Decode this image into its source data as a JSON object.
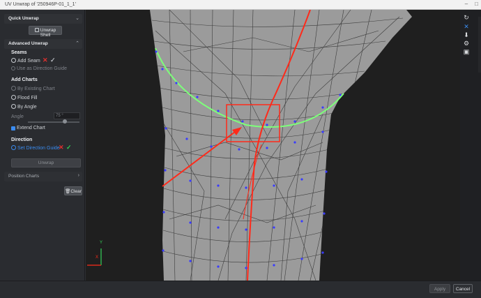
{
  "window": {
    "title": "UV Unwrap of '250946P-01_1_1'"
  },
  "quick_unwrap": {
    "header": "Quick Unwrap",
    "unwrap_shell": "Unwrap Shell"
  },
  "advanced_unwrap": {
    "header": "Advanced Unwrap",
    "seams": {
      "title": "Seams",
      "add_seam": "Add Seam",
      "use_direction_guide": "Use as Direction Guide"
    },
    "add_charts": {
      "title": "Add Charts",
      "by_existing_chart": "By Existing Chart",
      "flood_fill": "Flood Fill",
      "by_angle": "By Angle",
      "angle_label": "Angle",
      "angle_value": "75 °",
      "angle_fraction": 0.72,
      "extend_chart": "Extend Chart"
    },
    "direction": {
      "title": "Direction",
      "set_direction_guide": "Set Direction Guide"
    },
    "unwrap_button": "Unwrap"
  },
  "position_charts": {
    "header": "Position Charts"
  },
  "clear_button": "Clear",
  "axes": {
    "y": "Y",
    "x": "X"
  },
  "footer": {
    "apply": "Apply",
    "cancel": "Cancel"
  },
  "colors": {
    "accent_blue": "#3b8cf0",
    "seam_red": "#ff2a1a",
    "seam_green": "#7dff7a",
    "vertex_blue": "#3a3cff",
    "mesh_gray": "#9a9a9a"
  }
}
